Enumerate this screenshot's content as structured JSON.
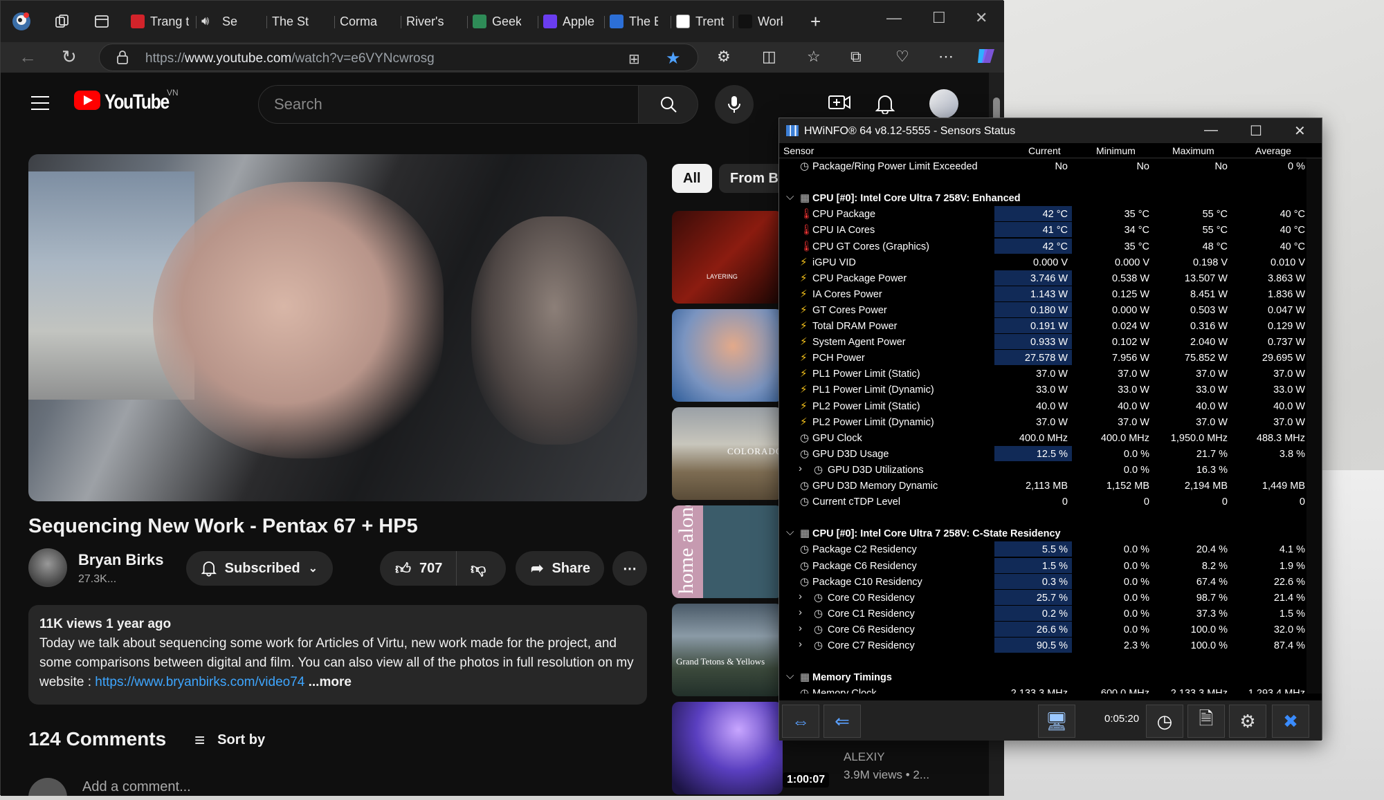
{
  "browser": {
    "tabs": [
      {
        "label": "Trang t",
        "icon": "zing-icon"
      },
      {
        "label": "Se",
        "icon": "speaker-icon",
        "active": true
      },
      {
        "label": "The St",
        "icon": "youtube-icon"
      },
      {
        "label": "Corma",
        "icon": "youtube-icon"
      },
      {
        "label": "River's",
        "icon": "youtube-icon"
      },
      {
        "label": "Geek F",
        "icon": "geek-icon"
      },
      {
        "label": "Apple",
        "icon": "v-icon"
      },
      {
        "label": "The Be",
        "icon": "f-icon"
      },
      {
        "label": "Trent F",
        "icon": "b-icon"
      },
      {
        "label": "Work",
        "icon": "work-icon"
      }
    ],
    "url_prefix": "https://",
    "url_host": "www.youtube.com",
    "url_path": "/watch?v=e6VYNcwrosg"
  },
  "youtube": {
    "logo_text": "YouTube",
    "country": "VN",
    "search_placeholder": "Search",
    "video_title": "Sequencing New Work - Pentax 67 + HP5",
    "channel_name": "Bryan Birks",
    "subscribers": "27.3K...",
    "subscribed_label": "Subscribed",
    "likes": "707",
    "share_label": "Share",
    "meta": "11K views  1 year ago",
    "description": "Today we talk about sequencing some work for Articles of Virtu, new work made for the project, and some comparisons between digital and film. You can also view all of the photos in full resolution on my website : ",
    "description_link": "https://www.bryanbirks.com/video74",
    "more_label": "...more",
    "comments_count": "124 Comments",
    "sort_label": "Sort by",
    "add_comment_placeholder": "Add a comment...",
    "chips": [
      "All",
      "From Br"
    ],
    "side_thumbs": [
      {
        "text": "LAYERING"
      },
      {
        "text": ""
      },
      {
        "text": "COLORADO"
      },
      {
        "text": "home alone"
      },
      {
        "text": "Grand Tetons & Yellows"
      },
      {
        "text": ""
      }
    ],
    "side_channel": "ALEXIY",
    "side_views": "3.9M views • 2...",
    "side_duration": "1:00:07"
  },
  "hwinfo": {
    "title": "HWiNFO® 64 v8.12-5555 - Sensors Status",
    "columns": [
      "Sensor",
      "Current",
      "Minimum",
      "Maximum",
      "Average"
    ],
    "elapsed": "0:05:20",
    "rows": [
      {
        "type": "item",
        "icon": "clock",
        "name": "Package/Ring Power Limit Exceeded",
        "cur": "No",
        "min": "No",
        "max": "No",
        "avg": "0 %"
      },
      {
        "type": "blank"
      },
      {
        "type": "head",
        "name": "CPU [#0]: Intel Core Ultra 7 258V: Enhanced"
      },
      {
        "type": "item",
        "icon": "temp",
        "name": "CPU Package",
        "cur": "42 °C",
        "min": "35 °C",
        "max": "55 °C",
        "avg": "40 °C",
        "hl": true
      },
      {
        "type": "item",
        "icon": "temp",
        "name": "CPU IA Cores",
        "cur": "41 °C",
        "min": "34 °C",
        "max": "55 °C",
        "avg": "40 °C",
        "hl": true
      },
      {
        "type": "item",
        "icon": "temp",
        "name": "CPU GT Cores (Graphics)",
        "cur": "42 °C",
        "min": "35 °C",
        "max": "48 °C",
        "avg": "40 °C",
        "hl": true
      },
      {
        "type": "item",
        "icon": "bolt",
        "name": "iGPU VID",
        "cur": "0.000 V",
        "min": "0.000 V",
        "max": "0.198 V",
        "avg": "0.010 V"
      },
      {
        "type": "item",
        "icon": "bolt",
        "name": "CPU Package Power",
        "cur": "3.746 W",
        "min": "0.538 W",
        "max": "13.507 W",
        "avg": "3.863 W",
        "hl": true
      },
      {
        "type": "item",
        "icon": "bolt",
        "name": "IA Cores Power",
        "cur": "1.143 W",
        "min": "0.125 W",
        "max": "8.451 W",
        "avg": "1.836 W",
        "hl": true
      },
      {
        "type": "item",
        "icon": "bolt",
        "name": "GT Cores Power",
        "cur": "0.180 W",
        "min": "0.000 W",
        "max": "0.503 W",
        "avg": "0.047 W",
        "hl": true
      },
      {
        "type": "item",
        "icon": "bolt",
        "name": "Total DRAM Power",
        "cur": "0.191 W",
        "min": "0.024 W",
        "max": "0.316 W",
        "avg": "0.129 W",
        "hl": true
      },
      {
        "type": "item",
        "icon": "bolt",
        "name": "System Agent Power",
        "cur": "0.933 W",
        "min": "0.102 W",
        "max": "2.040 W",
        "avg": "0.737 W",
        "hl": true
      },
      {
        "type": "item",
        "icon": "bolt",
        "name": "PCH Power",
        "cur": "27.578 W",
        "min": "7.956 W",
        "max": "75.852 W",
        "avg": "29.695 W",
        "hl": true
      },
      {
        "type": "item",
        "icon": "bolt",
        "name": "PL1 Power Limit (Static)",
        "cur": "37.0 W",
        "min": "37.0 W",
        "max": "37.0 W",
        "avg": "37.0 W"
      },
      {
        "type": "item",
        "icon": "bolt",
        "name": "PL1 Power Limit (Dynamic)",
        "cur": "33.0 W",
        "min": "33.0 W",
        "max": "33.0 W",
        "avg": "33.0 W"
      },
      {
        "type": "item",
        "icon": "bolt",
        "name": "PL2 Power Limit (Static)",
        "cur": "40.0 W",
        "min": "40.0 W",
        "max": "40.0 W",
        "avg": "40.0 W"
      },
      {
        "type": "item",
        "icon": "bolt",
        "name": "PL2 Power Limit (Dynamic)",
        "cur": "37.0 W",
        "min": "37.0 W",
        "max": "37.0 W",
        "avg": "37.0 W"
      },
      {
        "type": "item",
        "icon": "clock",
        "name": "GPU Clock",
        "cur": "400.0 MHz",
        "min": "400.0 MHz",
        "max": "1,950.0 MHz",
        "avg": "488.3 MHz"
      },
      {
        "type": "item",
        "icon": "clock",
        "name": "GPU D3D Usage",
        "cur": "12.5 %",
        "min": "0.0 %",
        "max": "21.7 %",
        "avg": "3.8 %",
        "hl": true
      },
      {
        "type": "sub",
        "icon": "clock",
        "name": "GPU D3D Utilizations",
        "cur": "",
        "min": "0.0 %",
        "max": "16.3 %",
        "avg": ""
      },
      {
        "type": "item",
        "icon": "clock",
        "name": "GPU D3D Memory Dynamic",
        "cur": "2,113 MB",
        "min": "1,152 MB",
        "max": "2,194 MB",
        "avg": "1,449 MB"
      },
      {
        "type": "item",
        "icon": "clock",
        "name": "Current cTDP Level",
        "cur": "0",
        "min": "0",
        "max": "0",
        "avg": "0"
      },
      {
        "type": "blank"
      },
      {
        "type": "head",
        "name": "CPU [#0]: Intel Core Ultra 7 258V: C-State Residency"
      },
      {
        "type": "item",
        "icon": "clock",
        "name": "Package C2 Residency",
        "cur": "5.5 %",
        "min": "0.0 %",
        "max": "20.4 %",
        "avg": "4.1 %",
        "hl": true
      },
      {
        "type": "item",
        "icon": "clock",
        "name": "Package C6 Residency",
        "cur": "1.5 %",
        "min": "0.0 %",
        "max": "8.2 %",
        "avg": "1.9 %",
        "hl": true
      },
      {
        "type": "item",
        "icon": "clock",
        "name": "Package C10 Residency",
        "cur": "0.3 %",
        "min": "0.0 %",
        "max": "67.4 %",
        "avg": "22.6 %",
        "hl": true
      },
      {
        "type": "sub",
        "icon": "clock",
        "name": "Core C0 Residency",
        "cur": "25.7 %",
        "min": "0.0 %",
        "max": "98.7 %",
        "avg": "21.4 %",
        "hl": true
      },
      {
        "type": "sub",
        "icon": "clock",
        "name": "Core C1 Residency",
        "cur": "0.2 %",
        "min": "0.0 %",
        "max": "37.3 %",
        "avg": "1.5 %",
        "hl": true
      },
      {
        "type": "sub",
        "icon": "clock",
        "name": "Core C6 Residency",
        "cur": "26.6 %",
        "min": "0.0 %",
        "max": "100.0 %",
        "avg": "32.0 %",
        "hl": true
      },
      {
        "type": "sub",
        "icon": "clock",
        "name": "Core C7 Residency",
        "cur": "90.5 %",
        "min": "2.3 %",
        "max": "100.0 %",
        "avg": "87.4 %",
        "hl": true
      },
      {
        "type": "blank"
      },
      {
        "type": "head",
        "name": "Memory Timings"
      },
      {
        "type": "item",
        "icon": "clock",
        "name": "Memory Clock",
        "cur": "2,133.3 MHz",
        "min": "600.0 MHz",
        "max": "2,133.3 MHz",
        "avg": "1,293.4 MHz"
      }
    ]
  }
}
